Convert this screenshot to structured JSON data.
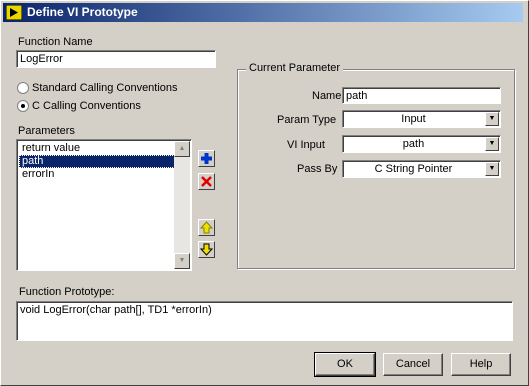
{
  "window": {
    "title": "Define VI Prototype"
  },
  "function_name": {
    "label": "Function Name",
    "value": "LogError"
  },
  "calling_conventions": {
    "options": [
      "Standard Calling Conventions",
      "C Calling Conventions"
    ],
    "selected": "C Calling Conventions"
  },
  "parameters": {
    "label": "Parameters",
    "items": [
      "return value",
      "path",
      "errorIn"
    ],
    "selected": "path"
  },
  "current_parameter": {
    "legend": "Current Parameter",
    "name_label": "Name",
    "name_value": "path",
    "param_type_label": "Param Type",
    "param_type_value": "Input",
    "vi_input_label": "VI Input",
    "vi_input_value": "path",
    "pass_by_label": "Pass By",
    "pass_by_value": "C String Pointer"
  },
  "prototype": {
    "label": "Function Prototype:",
    "value": "void LogError(char path[], TD1 *errorIn)"
  },
  "buttons": {
    "ok": "OK",
    "cancel": "Cancel",
    "help": "Help"
  },
  "colors": {
    "titlebar": "#0a246a",
    "dialog": "#d4d0c8",
    "add": "#0033cc",
    "delete": "#e00000",
    "move": "#f0e000"
  }
}
